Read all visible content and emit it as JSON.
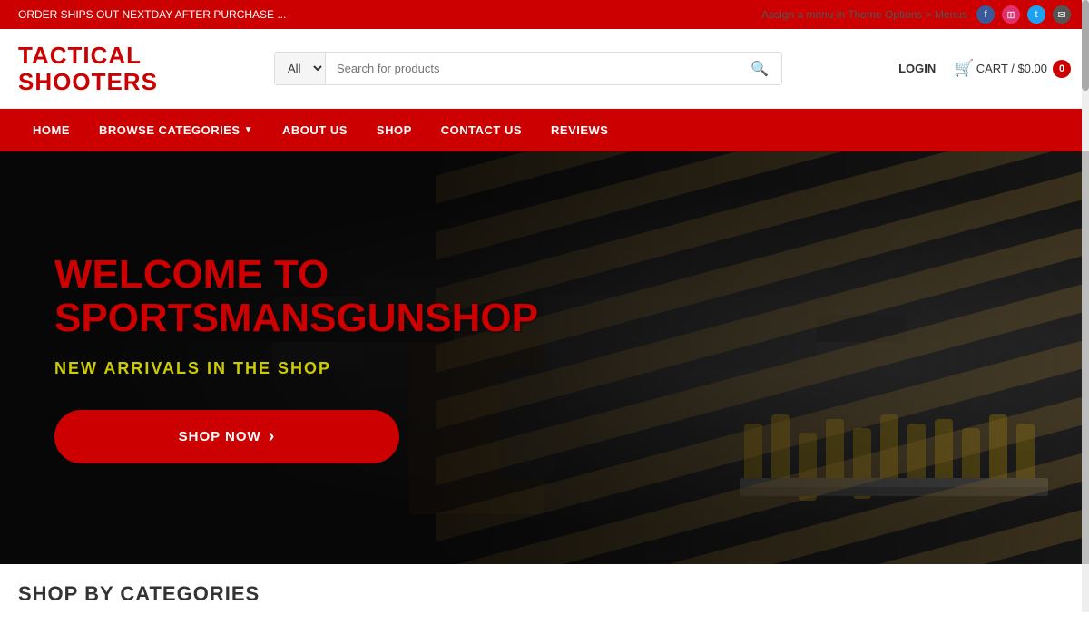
{
  "announcement": {
    "message": "ORDER SHIPS OUT NEXTDAY AFTER PURCHASE ...",
    "theme_menu_text": "Assign a menu in Theme Options > Menus"
  },
  "social": {
    "icons": [
      "f",
      "ig",
      "tw",
      "mail"
    ]
  },
  "header": {
    "logo_line1": "TACTICAL",
    "logo_line2": "SHOOTERS",
    "search": {
      "category_default": "All",
      "placeholder": "Search for products"
    },
    "login_label": "LOGIN",
    "cart_label": "CART / $0.00",
    "cart_count": "0"
  },
  "nav": {
    "items": [
      {
        "label": "HOME",
        "has_dropdown": false
      },
      {
        "label": "BROWSE CATEGORIES",
        "has_dropdown": true
      },
      {
        "label": "ABOUT US",
        "has_dropdown": false
      },
      {
        "label": "SHOP",
        "has_dropdown": false
      },
      {
        "label": "CONTACT US",
        "has_dropdown": false
      },
      {
        "label": "REVIEWS",
        "has_dropdown": false
      }
    ]
  },
  "hero": {
    "title_line1": "WELCOME TO",
    "title_line2": "SPORTSMANSGUNSHOP",
    "subtitle": "NEW ARRIVALS IN THE SHOP",
    "cta_label": "SHOP NOW",
    "cta_arrow": "›"
  },
  "categories_section": {
    "title": "SHOP BY CATEGORIES"
  }
}
